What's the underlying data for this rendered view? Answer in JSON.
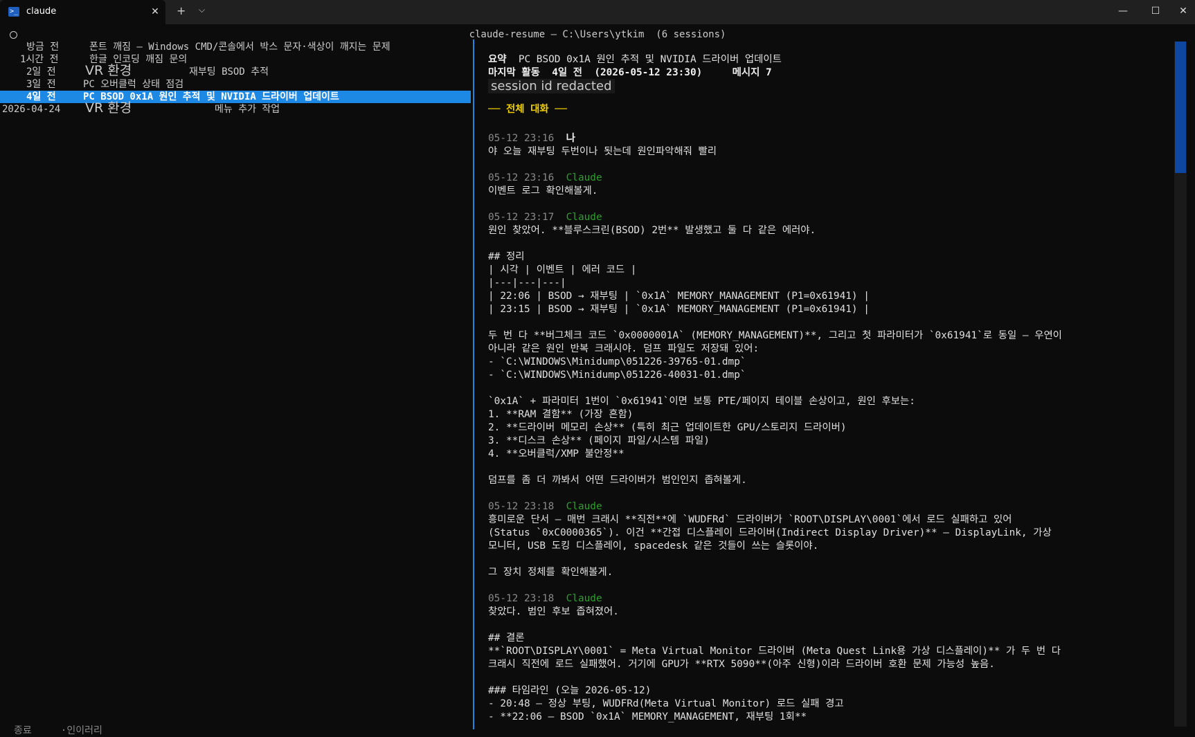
{
  "tab": {
    "title": "claude",
    "close": "✕",
    "new": "+",
    "dropdown": "⌵"
  },
  "window": {
    "minimize": "—",
    "maximize": "☐",
    "close": "✕"
  },
  "header": {
    "title": "claude-resume — C:\\Users\\ytkim  (6 sessions)"
  },
  "sessions": [
    {
      "time": "방금 전",
      "title": "폰트 깨짐 – Windows CMD/콘솔에서 박스 문자·색상이 깨지는 문제"
    },
    {
      "time": "1시간 전",
      "title": "한글 인코딩 깨짐 문의"
    },
    {
      "time": "2일 전",
      "project": "VR 환경",
      "title": "재부팅 BSOD 추적"
    },
    {
      "time": "3일 전",
      "title": "PC 오버클럭 상태 점검"
    },
    {
      "time": "4일 전",
      "title": "PC BSOD 0x1A 원인 추적 및 NVIDIA 드라이버 업데이트"
    },
    {
      "time": "2026-04-24",
      "project": "VR 환경",
      "title": "메뉴 추가 작업"
    }
  ],
  "partial_footer": "종료     ·인이러리",
  "detail": {
    "summary_label": "요약",
    "summary": "PC BSOD 0x1A 원인 추적 및 NVIDIA 드라이버 업데이트",
    "activity_label": "마지막 활동",
    "activity": "4일 전  (2026-05-12 23:30)",
    "messages_label": "메시지",
    "messages": "7",
    "session_id": "session id redacted",
    "section_title": "── 전체 대화 ──",
    "messages_list": [
      {
        "time": "05-12 23:16",
        "author": "나",
        "lines": [
          "야 오늘 재부팅 두번이나 됫는데 원인파악해줘 빨리"
        ]
      },
      {
        "time": "05-12 23:16",
        "author": "Claude",
        "lines": [
          "이벤트 로그 확인해볼게."
        ]
      },
      {
        "time": "05-12 23:17",
        "author": "Claude",
        "lines": [
          "원인 찾았어. **블루스크린(BSOD) 2번** 발생했고 둘 다 같은 에러야.",
          "",
          "## 정리",
          "| 시각 | 이벤트 | 에러 코드 |",
          "|---|---|---|",
          "| 22:06 | BSOD → 재부팅 | `0x1A` MEMORY_MANAGEMENT (P1=0x61941) |",
          "| 23:15 | BSOD → 재부팅 | `0x1A` MEMORY_MANAGEMENT (P1=0x61941) |",
          "",
          "두 번 다 **버그체크 코드 `0x0000001A` (MEMORY_MANAGEMENT)**, 그리고 첫 파라미터가 `0x61941`로 동일 – 우연이",
          "아니라 같은 원인 반복 크래시야. 덤프 파일도 저장돼 있어:",
          "- `C:\\WINDOWS\\Minidump\\051226-39765-01.dmp`",
          "- `C:\\WINDOWS\\Minidump\\051226-40031-01.dmp`",
          "",
          "`0x1A` + 파라미터 1번이 `0x61941`이면 보통 PTE/페이지 테이블 손상이고, 원인 후보는:",
          "1. **RAM 결함** (가장 흔함)",
          "2. **드라이버 메모리 손상** (특히 최근 업데이트한 GPU/스토리지 드라이버)",
          "3. **디스크 손상** (페이지 파일/시스템 파일)",
          "4. **오버클럭/XMP 불안정**",
          "",
          "덤프를 좀 더 까봐서 어떤 드라이버가 범인인지 좁혀볼게."
        ]
      },
      {
        "time": "05-12 23:18",
        "author": "Claude",
        "lines": [
          "흥미로운 단서 – 매번 크래시 **직전**에 `WUDFRd` 드라이버가 `ROOT\\DISPLAY\\0001`에서 로드 실패하고 있어",
          "(Status `0xC0000365`). 이건 **간접 디스플레이 드라이버(Indirect Display Driver)** – DisplayLink, 가상",
          "모니터, USB 도킹 디스플레이, spacedesk 같은 것들이 쓰는 슬롯이야.",
          "",
          "그 장치 정체를 확인해볼게."
        ]
      },
      {
        "time": "05-12 23:18",
        "author": "Claude",
        "lines": [
          "찾았다. 범인 후보 좁혀졌어.",
          "",
          "## 결론",
          "**`ROOT\\DISPLAY\\0001` = Meta Virtual Monitor 드라이버 (Meta Quest Link용 가상 디스플레이)** 가 두 번 다",
          "크래시 직전에 로드 실패했어. 거기에 GPU가 **RTX 5090**(아주 신형)이라 드라이버 호환 문제 가능성 높음.",
          "",
          "### 타임라인 (오늘 2026-05-12)",
          "- 20:48 – 정상 부팅, WUDFRd(Meta Virtual Monitor) 로드 실패 경고",
          "- **22:06 – BSOD `0x1A` MEMORY_MANAGEMENT, 재부팅 1회**"
        ]
      }
    ]
  },
  "colors": {
    "accent": "#1e88e5",
    "author_me": "#29b6f6",
    "author_claude": "#2e9e2e",
    "section": "#f0d000"
  }
}
